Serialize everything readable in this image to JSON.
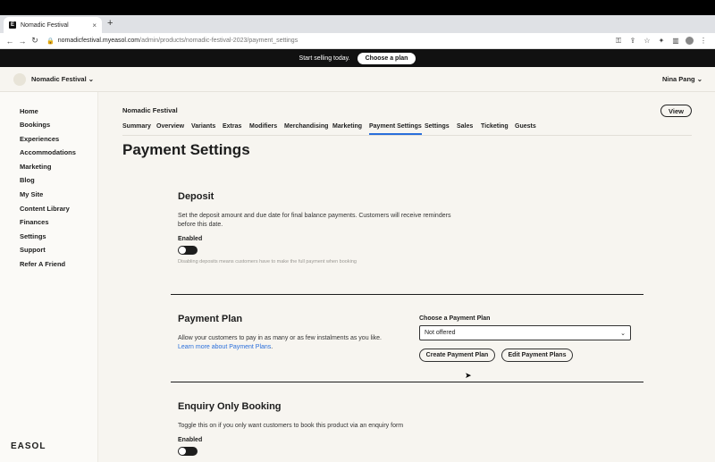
{
  "browser": {
    "tab_title": "Nomadic Festival",
    "favicon_text": "E",
    "new_tab": "+",
    "url_host": "nomadicfestival.myeasol.com",
    "url_path": "/admin/products/nomadic-festival-2023/payment_settings"
  },
  "promo": {
    "text": "Start selling today.",
    "button": "Choose a plan"
  },
  "header": {
    "site_name": "Nomadic Festival ⌄",
    "user_name": "Nina Pang ⌄"
  },
  "sidebar": {
    "items": [
      {
        "label": "Home"
      },
      {
        "label": "Bookings"
      },
      {
        "label": "Experiences"
      },
      {
        "label": "Accommodations"
      },
      {
        "label": "Marketing"
      },
      {
        "label": "Blog"
      },
      {
        "label": "My Site"
      },
      {
        "label": "Content Library"
      },
      {
        "label": "Finances"
      },
      {
        "label": "Settings"
      },
      {
        "label": "Support"
      },
      {
        "label": "Refer A Friend"
      }
    ],
    "brand": "EASOL"
  },
  "main": {
    "product_title": "Nomadic Festival",
    "view_button": "View",
    "tabs": [
      {
        "label": "Summary"
      },
      {
        "label": "Overview"
      },
      {
        "label": "Variants"
      },
      {
        "label": "Extras"
      },
      {
        "label": "Modifiers"
      },
      {
        "label": "Merchandising"
      },
      {
        "label": "Marketing"
      },
      {
        "label": "Payment Settings",
        "active": true
      },
      {
        "label": "Settings"
      },
      {
        "label": "Sales"
      },
      {
        "label": "Ticketing"
      },
      {
        "label": "Guests"
      }
    ],
    "page_title": "Payment Settings",
    "deposit": {
      "title": "Deposit",
      "description_1": "Set the deposit amount and due date for final balance payments. Customers will receive reminders",
      "description_2": "before this date.",
      "toggle_label": "Enabled",
      "hint": "Disabling deposits means customers have to make the full payment when booking"
    },
    "payment_plan": {
      "title": "Payment Plan",
      "description_1": "Allow your customers to pay in as many or as few instalments as you like.",
      "link_1": "Learn",
      "link_2": "more about Payment Plans",
      "period": ".",
      "choose_label": "Choose a Payment Plan",
      "select_value": "Not offered",
      "create_button": "Create Payment Plan",
      "edit_button": "Edit Payment Plans"
    },
    "enquiry": {
      "title": "Enquiry Only Booking",
      "description": "Toggle this on if you only want customers to book this product via an enquiry form",
      "toggle_label": "Enabled"
    }
  }
}
